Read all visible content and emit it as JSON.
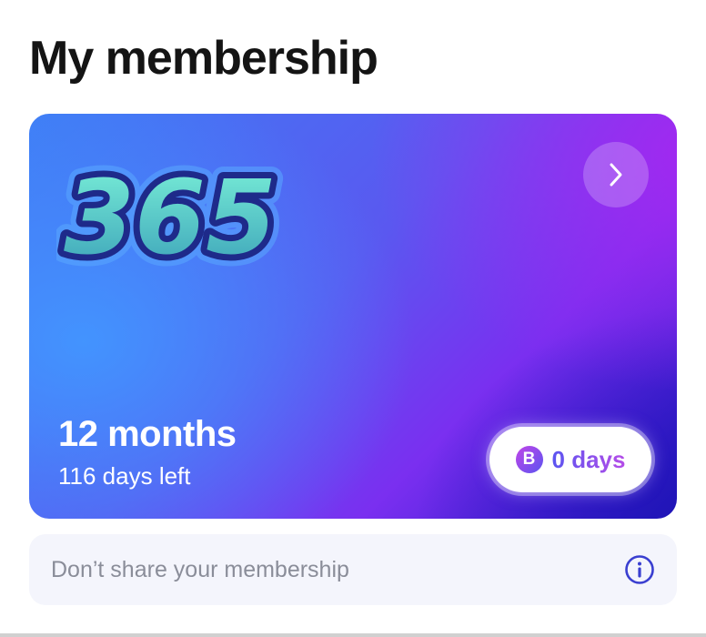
{
  "header": {
    "title": "My membership"
  },
  "membership_card": {
    "logo_text": "365",
    "plan_name": "12 months",
    "days_left": "116 days left",
    "next_icon": "chevron-right-icon",
    "bonus": {
      "icon_letter": "B",
      "label": "0 days"
    }
  },
  "notice": {
    "text": "Don’t share your membership",
    "icon": "info-icon"
  },
  "colors": {
    "accent": "#3a3fd0",
    "card_blue": "#3f7cf5",
    "card_purple": "#a528f0"
  }
}
